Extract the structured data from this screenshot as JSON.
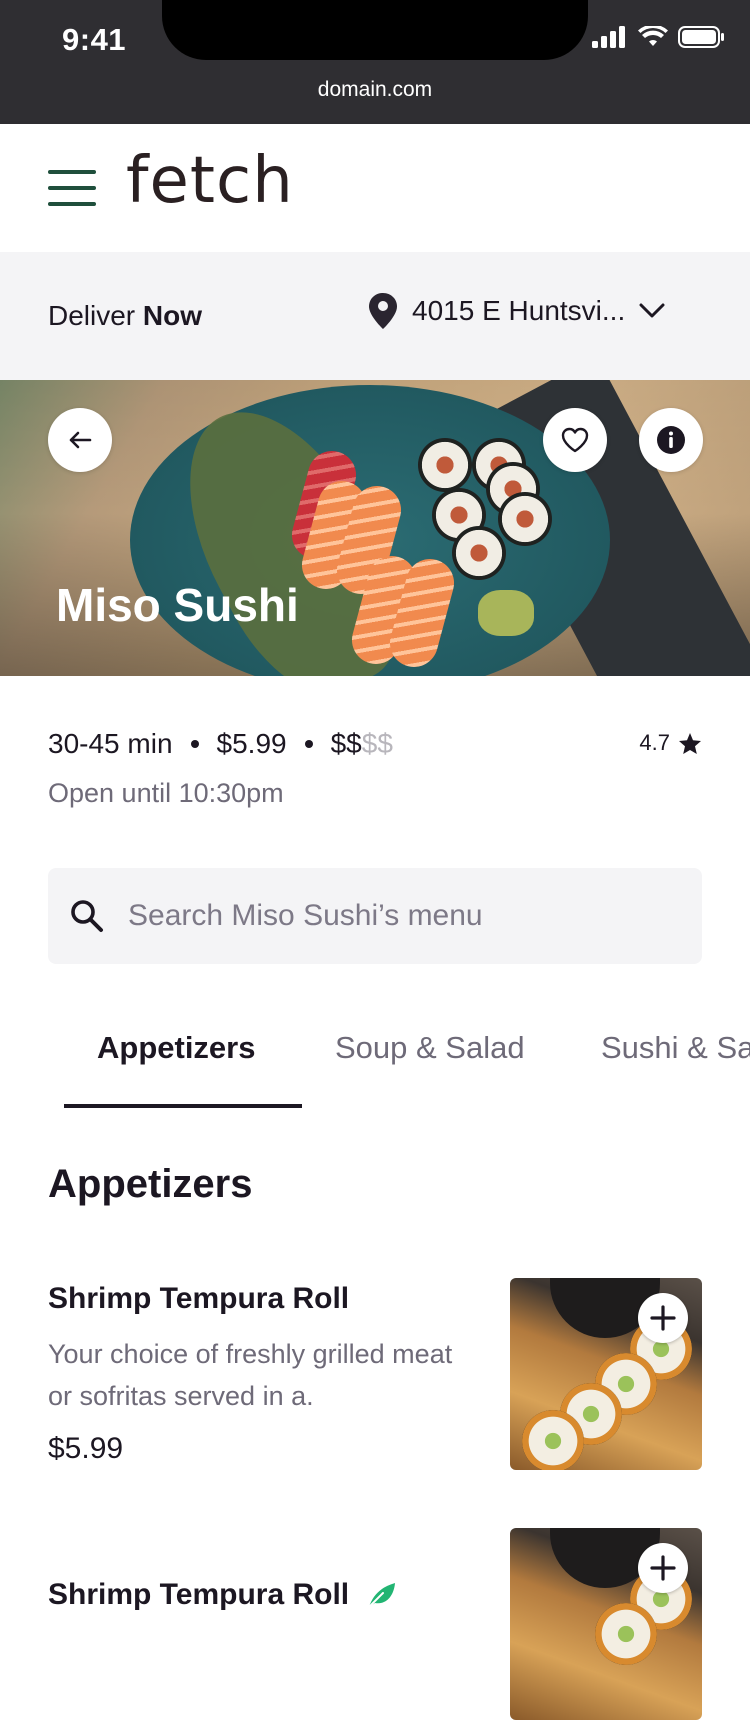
{
  "status_bar": {
    "time": "9:41",
    "url": "domain.com"
  },
  "header": {
    "logo": "fetch",
    "menu_icon": "hamburger-menu-icon"
  },
  "delivery": {
    "label": "Deliver",
    "mode": "Now",
    "address": "4015 E Huntsvi..."
  },
  "restaurant": {
    "name": "Miso Sushi",
    "delivery_time": "30-45 min",
    "delivery_fee": "$5.99",
    "price_level_active": "$$",
    "price_level_inactive": "$$",
    "rating": "4.7",
    "hours": "Open until 10:30pm"
  },
  "search": {
    "placeholder": "Search Miso Sushi’s menu"
  },
  "tabs": [
    {
      "label": "Appetizers",
      "active": true
    },
    {
      "label": "Soup & Salad",
      "active": false
    },
    {
      "label": "Sushi & Sa",
      "active": false
    }
  ],
  "section": {
    "title": "Appetizers"
  },
  "items": [
    {
      "name": "Shrimp Tempura Roll",
      "description": "Your choice of freshly grilled meat or sofritas served in a.",
      "price": "$5.99"
    },
    {
      "name": "Shrimp Tempura Roll",
      "badge_icon": "leaf-icon"
    }
  ],
  "colors": {
    "brand": "#1f4f3c",
    "status_bar": "#2f2e32",
    "muted_text": "#6e6a78",
    "leaf_badge": "#22b573"
  }
}
